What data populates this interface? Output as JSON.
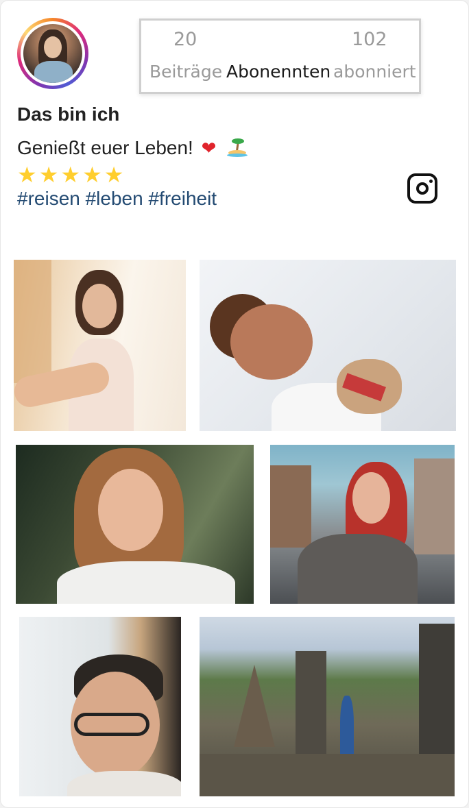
{
  "profile": {
    "stats": [
      {
        "value": "20",
        "label": "Beiträge"
      },
      {
        "value": "",
        "label": "Abonennten"
      },
      {
        "value": "102",
        "label": "abonniert"
      }
    ],
    "name": "Das bin ich",
    "tagline": "Genießt euer Leben!",
    "tagline_emoji_heart": "❤",
    "stars": "★★★★★",
    "rating": 5,
    "hashtags": "#reisen #leben #freiheit"
  },
  "icons": {
    "instagram": "instagram-icon",
    "island": "island-emoji-icon",
    "heart": "heart-emoji-icon"
  },
  "colors": {
    "hashtag": "#234a72",
    "stars": "#ffce2e",
    "stat_muted": "#9a9a9a",
    "stat_active": "#1c1c1c"
  },
  "gallery": [
    {
      "subject": "woman-leading-by-hand"
    },
    {
      "subject": "boy-with-pug"
    },
    {
      "subject": "smiling-woman-wavy-hair"
    },
    {
      "subject": "red-haired-woman-sunglasses"
    },
    {
      "subject": "smiling-man-glasses"
    },
    {
      "subject": "temple-landscape"
    }
  ]
}
